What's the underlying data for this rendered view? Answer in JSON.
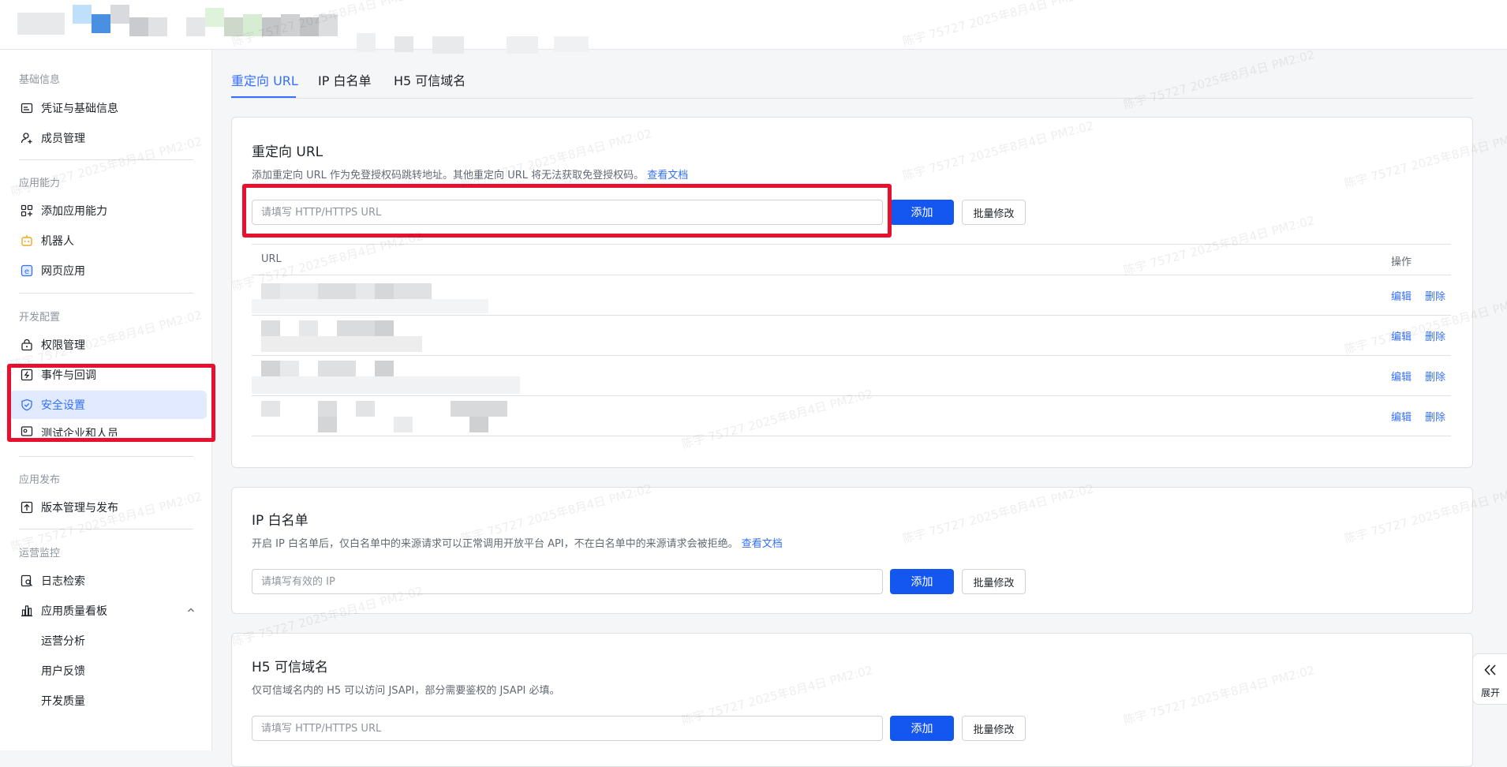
{
  "sidebar": {
    "groups": [
      {
        "title": "基础信息",
        "items": [
          {
            "label": "凭证与基础信息",
            "icon": "credential-icon"
          },
          {
            "label": "成员管理",
            "icon": "member-add-icon"
          }
        ]
      },
      {
        "title": "应用能力",
        "items": [
          {
            "label": "添加应用能力",
            "icon": "grid-add-icon"
          },
          {
            "label": "机器人",
            "icon": "robot-icon"
          },
          {
            "label": "网页应用",
            "icon": "web-app-icon"
          }
        ]
      },
      {
        "title": "开发配置",
        "items": [
          {
            "label": "权限管理",
            "icon": "lock-icon"
          },
          {
            "label": "事件与回调",
            "icon": "event-icon"
          },
          {
            "label": "安全设置",
            "icon": "shield-icon",
            "active": true
          },
          {
            "label": "测试企业和人员",
            "icon": "test-icon"
          }
        ]
      },
      {
        "title": "应用发布",
        "items": [
          {
            "label": "版本管理与发布",
            "icon": "upload-icon"
          }
        ]
      },
      {
        "title": "运营监控",
        "items": [
          {
            "label": "日志检索",
            "icon": "log-search-icon"
          },
          {
            "label": "应用质量看板",
            "icon": "bar-chart-icon"
          },
          {
            "label": "运营分析"
          },
          {
            "label": "用户反馈"
          },
          {
            "label": "开发质量"
          }
        ]
      }
    ]
  },
  "tabs": [
    "重定向 URL",
    "IP 白名单",
    "H5 可信域名"
  ],
  "redirect": {
    "title": "重定向 URL",
    "desc": "添加重定向 URL 作为免登授权码跳转地址。其他重定向 URL 将无法获取免登授权码。",
    "doc_link": "查看文档",
    "placeholder": "请填写 HTTP/HTTPS URL",
    "add": "添加",
    "batch": "批量修改",
    "col_url": "URL",
    "col_action": "操作",
    "edit": "编辑",
    "delete": "删除",
    "row_count": 4
  },
  "ip": {
    "title": "IP 白名单",
    "desc": "开启 IP 白名单后，仅白名单中的来源请求可以正常调用开放平台 API，不在白名单中的来源请求会被拒绝。",
    "doc_link": "查看文档",
    "placeholder": "请填写有效的 IP",
    "add": "添加",
    "batch": "批量修改"
  },
  "h5": {
    "title": "H5 可信域名",
    "desc": "仅可信域名内的 H5 可以访问 JSAPI，部分需要鉴权的 JSAPI 必填。",
    "placeholder": "请填写 HTTP/HTTPS URL",
    "add": "添加",
    "batch": "批量修改"
  },
  "expand_label": "展开",
  "watermark": "陈宇 75727 2025年8月4日 PM2:02",
  "colors": {
    "accent": "#3370ff",
    "primary_button": "#1456f0",
    "highlight_box": "#e8102e"
  }
}
